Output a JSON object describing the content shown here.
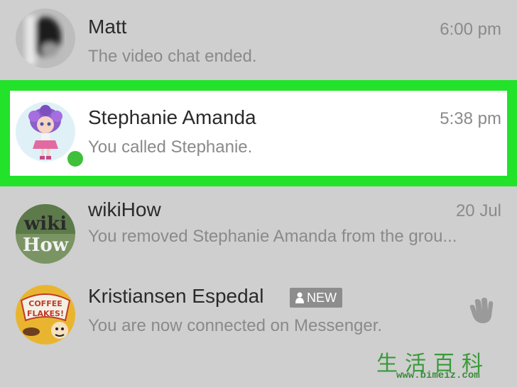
{
  "conversations": [
    {
      "name": "Matt",
      "preview": "The video chat ended.",
      "time": "6:00 pm",
      "avatar_icon": "blurred-person-avatar"
    },
    {
      "name": "Stephanie Amanda",
      "preview": "You called Stephanie.",
      "time": "5:38 pm",
      "avatar_icon": "doll-avatar",
      "online": true,
      "highlighted": true
    },
    {
      "name": "wikiHow",
      "preview": "You removed Stephanie Amanda from the grou...",
      "time": "20 Jul",
      "avatar_icon": "wikihow-logo-avatar",
      "logo_text": [
        "wiki",
        "How"
      ]
    },
    {
      "name": "Kristiansen Espedal",
      "preview": "You are now connected on Messenger.",
      "badge": "NEW",
      "avatar_icon": "coffee-flakes-avatar",
      "wave_icon": "wave-hand-icon"
    }
  ],
  "watermark": {
    "chars": "生活百科",
    "url": "www.bimeiz.com"
  },
  "colors": {
    "highlight": "#22e22a",
    "online": "#3fbf3a",
    "background": "#cfcfcf"
  }
}
